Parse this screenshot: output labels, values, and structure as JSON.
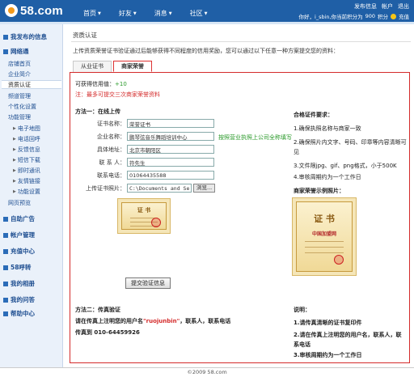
{
  "header": {
    "logo_text": "58.com",
    "nav": [
      {
        "label": "首页"
      },
      {
        "label": "好友"
      },
      {
        "label": "消息"
      },
      {
        "label": "社区"
      }
    ],
    "top_links": [
      "发布信息",
      "帐户",
      "退出"
    ],
    "user_text": "你好，i_sbin,你当前积分为",
    "points": "900",
    "points_unit": "积分",
    "recharge": "充值"
  },
  "sidebar": {
    "sections": [
      {
        "label": "我发布的信息"
      },
      {
        "label": "网络通"
      },
      {
        "label": "自助广告"
      },
      {
        "label": "帐户管理"
      },
      {
        "label": "充值中心"
      },
      {
        "label": "58呼转"
      },
      {
        "label": "我的相册"
      },
      {
        "label": "我的问答"
      },
      {
        "label": "帮助中心"
      }
    ],
    "items": [
      {
        "label": "店铺首页"
      },
      {
        "label": "企业简介"
      },
      {
        "label": "资质认证"
      },
      {
        "label": "频道管理"
      },
      {
        "label": "个性化设置"
      },
      {
        "label": "功能管理"
      }
    ],
    "subitems": [
      {
        "label": "电子地图"
      },
      {
        "label": "电话回呼"
      },
      {
        "label": "反馈信息"
      },
      {
        "label": "短信下载"
      },
      {
        "label": "即时通讯"
      },
      {
        "label": "友情链接"
      },
      {
        "label": "功能设置"
      }
    ],
    "extra_item": "网页预览"
  },
  "main": {
    "page_title": "资质认证",
    "intro": "上传资质荣誉证书验证通过后能够获得不同程度的信用奖励，您可以通过以下任意一种方案提交您的资料：",
    "tabs": [
      {
        "label": "从业证书"
      },
      {
        "label": "商家荣誉"
      }
    ],
    "credit_label": "可获得信用值：",
    "credit_value": "+10",
    "note": "注：最多可提交三次商家荣誉资料",
    "method1_title": "方法一：在线上传",
    "form": {
      "cert_name_label": "证书名称：",
      "cert_name_value": "荣誉证书",
      "company_label": "企业名称：",
      "company_value": "鹏琴弦音乐舞蹈培训中心",
      "company_hint": "按照营业执照上公司全称填写",
      "address_label": "具体地址：",
      "address_value": "北京市朝阳区",
      "contact_label": "联 系 人：",
      "contact_value": "符先生",
      "phone_label": "联系电话：",
      "phone_value": "01064435588",
      "upload_label": "上传证书照片：",
      "upload_value": "C:\\Documents and Sett",
      "browse_label": "浏览...",
      "submit_label": "提交验证信息"
    },
    "cert_title_small": "证  书",
    "requirements": {
      "title": "合格证件要求：",
      "items": [
        "1.确保执照名称与商家一致",
        "2.确保照片内文字、号码、印章等内容清晰可见",
        "3.文件限jpg、gif、png格式，小于500K",
        "4.审核周期约为一个工作日"
      ],
      "example_title": "商家荣誉示例照片：",
      "example_cert_title": "证  书",
      "example_cert_subtitle": "中国加盟网"
    },
    "method2": {
      "title": "方法二：传真验证",
      "line1_pre": "请在传真上注明您的用户名",
      "username": "\"ruojunbin\"",
      "line1_post": "，联系人，联系电话",
      "line2": "传真到 010-64459926"
    },
    "notes": {
      "title": "说明：",
      "items": [
        "1.请传真清晰的证书复印件",
        "2.请在传真上注明您的用户名，联系人，联系电话",
        "3.审核周期约为一个工作日"
      ]
    }
  },
  "footer": {
    "copyright": "©2009 58.com"
  },
  "colors": {
    "brand_blue": "#1f5fa6",
    "accent_red": "#d42b2b",
    "accent_green": "#2a9a2a"
  }
}
